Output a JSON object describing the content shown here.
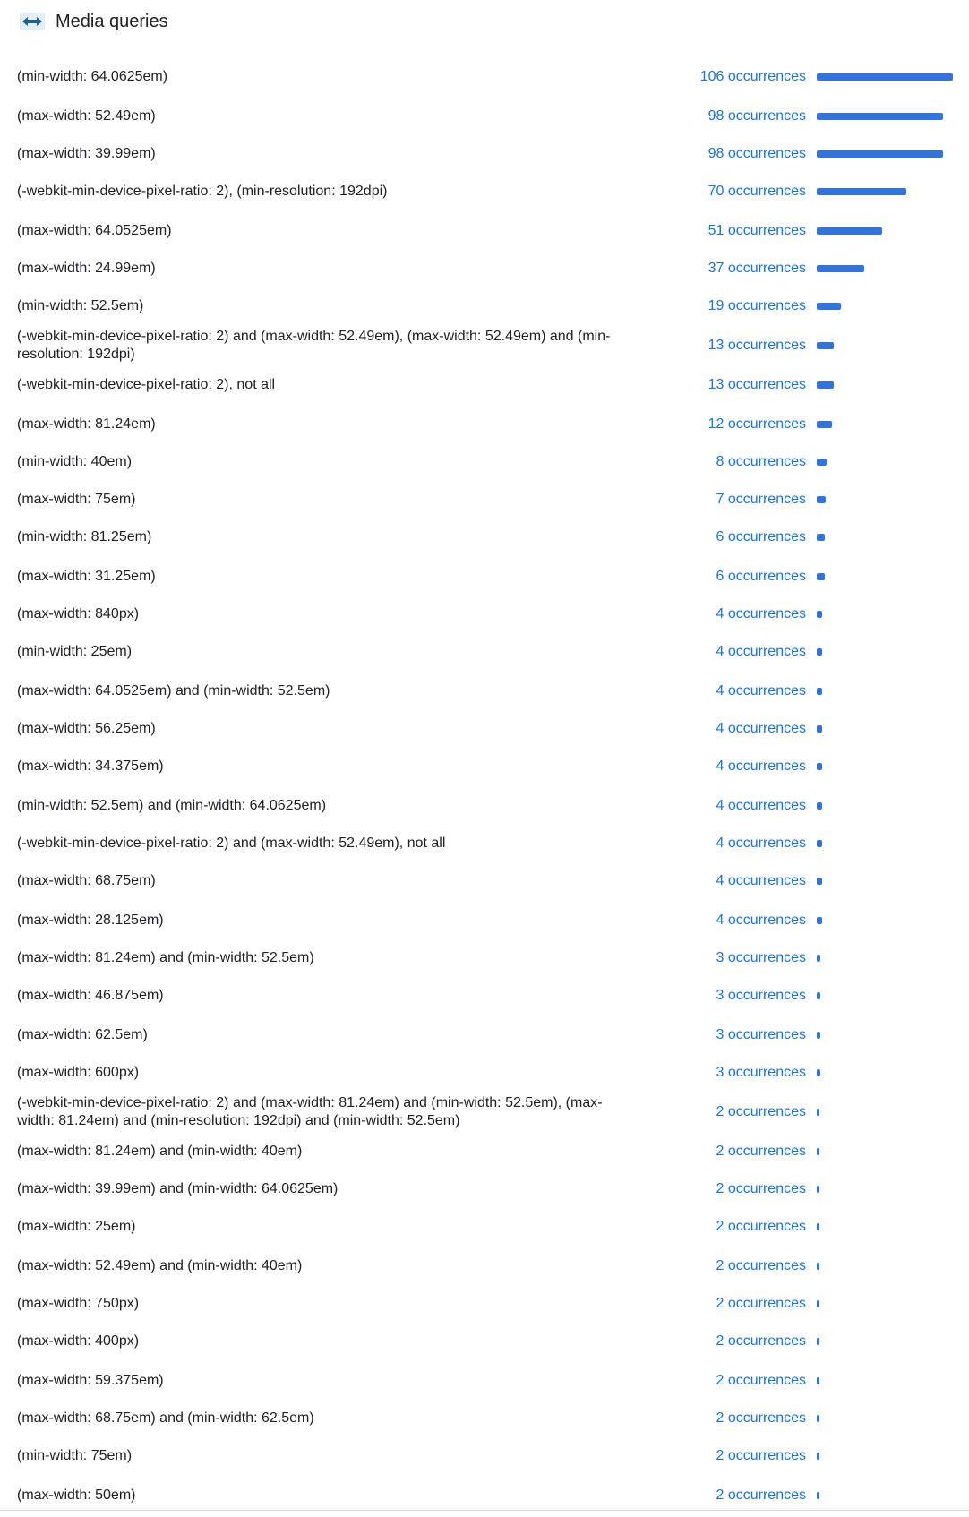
{
  "section": {
    "title": "Media queries",
    "icon": "arrows-horizontal-icon"
  },
  "colors": {
    "accent": "#1a73e8",
    "bar": "#3273dc"
  },
  "max_occurrences": 106,
  "rows": [
    {
      "query": "(min-width: 64.0625em)",
      "count_label": "106 occurrences",
      "count": 106
    },
    {
      "query": "(max-width: 52.49em)",
      "count_label": "98 occurrences",
      "count": 98
    },
    {
      "query": "(max-width: 39.99em)",
      "count_label": "98 occurrences",
      "count": 98
    },
    {
      "query": "(-webkit-min-device-pixel-ratio: 2), (min-resolution: 192dpi)",
      "count_label": "70 occurrences",
      "count": 70
    },
    {
      "query": "(max-width: 64.0525em)",
      "count_label": "51 occurrences",
      "count": 51
    },
    {
      "query": "(max-width: 24.99em)",
      "count_label": "37 occurrences",
      "count": 37
    },
    {
      "query": "(min-width: 52.5em)",
      "count_label": "19 occurrences",
      "count": 19
    },
    {
      "query": "(-webkit-min-device-pixel-ratio: 2) and (max-width: 52.49em), (max-width: 52.49em) and (min-resolution: 192dpi)",
      "count_label": "13 occurrences",
      "count": 13
    },
    {
      "query": "(-webkit-min-device-pixel-ratio: 2), not all",
      "count_label": "13 occurrences",
      "count": 13
    },
    {
      "query": "(max-width: 81.24em)",
      "count_label": "12 occurrences",
      "count": 12
    },
    {
      "query": "(min-width: 40em)",
      "count_label": "8 occurrences",
      "count": 8
    },
    {
      "query": "(max-width: 75em)",
      "count_label": "7 occurrences",
      "count": 7
    },
    {
      "query": "(min-width: 81.25em)",
      "count_label": "6 occurrences",
      "count": 6
    },
    {
      "query": "(max-width: 31.25em)",
      "count_label": "6 occurrences",
      "count": 6
    },
    {
      "query": "(max-width: 840px)",
      "count_label": "4 occurrences",
      "count": 4
    },
    {
      "query": "(min-width: 25em)",
      "count_label": "4 occurrences",
      "count": 4
    },
    {
      "query": "(max-width: 64.0525em) and (min-width: 52.5em)",
      "count_label": "4 occurrences",
      "count": 4
    },
    {
      "query": "(max-width: 56.25em)",
      "count_label": "4 occurrences",
      "count": 4
    },
    {
      "query": "(max-width: 34.375em)",
      "count_label": "4 occurrences",
      "count": 4
    },
    {
      "query": "(min-width: 52.5em) and (min-width: 64.0625em)",
      "count_label": "4 occurrences",
      "count": 4
    },
    {
      "query": "(-webkit-min-device-pixel-ratio: 2) and (max-width: 52.49em), not all",
      "count_label": "4 occurrences",
      "count": 4
    },
    {
      "query": "(max-width: 68.75em)",
      "count_label": "4 occurrences",
      "count": 4
    },
    {
      "query": "(max-width: 28.125em)",
      "count_label": "4 occurrences",
      "count": 4
    },
    {
      "query": "(max-width: 81.24em) and (min-width: 52.5em)",
      "count_label": "3 occurrences",
      "count": 3
    },
    {
      "query": "(max-width: 46.875em)",
      "count_label": "3 occurrences",
      "count": 3
    },
    {
      "query": "(max-width: 62.5em)",
      "count_label": "3 occurrences",
      "count": 3
    },
    {
      "query": "(max-width: 600px)",
      "count_label": "3 occurrences",
      "count": 3
    },
    {
      "query": "(-webkit-min-device-pixel-ratio: 2) and (max-width: 81.24em) and (min-width: 52.5em), (max-width: 81.24em) and (min-resolution: 192dpi) and (min-width: 52.5em)",
      "count_label": "2 occurrences",
      "count": 2
    },
    {
      "query": "(max-width: 81.24em) and (min-width: 40em)",
      "count_label": "2 occurrences",
      "count": 2
    },
    {
      "query": "(max-width: 39.99em) and (min-width: 64.0625em)",
      "count_label": "2 occurrences",
      "count": 2
    },
    {
      "query": "(max-width: 25em)",
      "count_label": "2 occurrences",
      "count": 2
    },
    {
      "query": "(max-width: 52.49em) and (min-width: 40em)",
      "count_label": "2 occurrences",
      "count": 2
    },
    {
      "query": "(max-width: 750px)",
      "count_label": "2 occurrences",
      "count": 2
    },
    {
      "query": "(max-width: 400px)",
      "count_label": "2 occurrences",
      "count": 2
    },
    {
      "query": "(max-width: 59.375em)",
      "count_label": "2 occurrences",
      "count": 2
    },
    {
      "query": "(max-width: 68.75em) and (min-width: 62.5em)",
      "count_label": "2 occurrences",
      "count": 2
    },
    {
      "query": "(min-width: 75em)",
      "count_label": "2 occurrences",
      "count": 2
    },
    {
      "query": "(max-width: 50em)",
      "count_label": "2 occurrences",
      "count": 2
    }
  ]
}
